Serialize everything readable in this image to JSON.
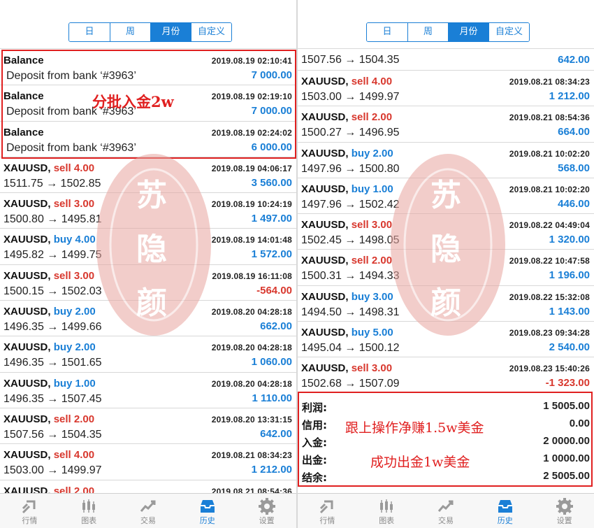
{
  "tabs_period": [
    "日",
    "周",
    "月份",
    "自定义"
  ],
  "active_period": "月份",
  "left": {
    "rows": [
      {
        "kind": "balance",
        "title": "Balance",
        "time": "2019.08.19 02:10:41",
        "desc": "Deposit from bank  ‘#3963’",
        "amount": "7 000.00"
      },
      {
        "kind": "balance",
        "title": "Balance",
        "time": "2019.08.19 02:19:10",
        "desc": "Deposit from bank  ‘#3963’",
        "amount": "7 000.00"
      },
      {
        "kind": "balance",
        "title": "Balance",
        "time": "2019.08.19 02:24:02",
        "desc": "Deposit from bank  ‘#3963’",
        "amount": "6 000.00"
      },
      {
        "kind": "trade",
        "symbol": "XAUUSD,",
        "action": "sell",
        "lots": "4.00",
        "time": "2019.08.19 04:06:17",
        "prices": "1511.75 → 1502.85",
        "amount": "3 560.00",
        "neg": false
      },
      {
        "kind": "trade",
        "symbol": "XAUUSD,",
        "action": "sell",
        "lots": "3.00",
        "time": "2019.08.19 10:24:19",
        "prices": "1500.80 → 1495.81",
        "amount": "1 497.00",
        "neg": false
      },
      {
        "kind": "trade",
        "symbol": "XAUUSD,",
        "action": "buy",
        "lots": "4.00",
        "time": "2019.08.19 14:01:48",
        "prices": "1495.82 → 1499.75",
        "amount": "1 572.00",
        "neg": false
      },
      {
        "kind": "trade",
        "symbol": "XAUUSD,",
        "action": "sell",
        "lots": "3.00",
        "time": "2019.08.19 16:11:08",
        "prices": "1500.15 → 1502.03",
        "amount": "-564.00",
        "neg": true
      },
      {
        "kind": "trade",
        "symbol": "XAUUSD,",
        "action": "buy",
        "lots": "2.00",
        "time": "2019.08.20 04:28:18",
        "prices": "1496.35 → 1499.66",
        "amount": "662.00",
        "neg": false
      },
      {
        "kind": "trade",
        "symbol": "XAUUSD,",
        "action": "buy",
        "lots": "2.00",
        "time": "2019.08.20 04:28:18",
        "prices": "1496.35 → 1501.65",
        "amount": "1 060.00",
        "neg": false
      },
      {
        "kind": "trade",
        "symbol": "XAUUSD,",
        "action": "buy",
        "lots": "1.00",
        "time": "2019.08.20 04:28:18",
        "prices": "1496.35 → 1507.45",
        "amount": "1 110.00",
        "neg": false
      },
      {
        "kind": "trade",
        "symbol": "XAUUSD,",
        "action": "sell",
        "lots": "2.00",
        "time": "2019.08.20 13:31:15",
        "prices": "1507.56 → 1504.35",
        "amount": "642.00",
        "neg": false
      },
      {
        "kind": "trade",
        "symbol": "XAUUSD,",
        "action": "sell",
        "lots": "4.00",
        "time": "2019.08.21 08:34:23",
        "prices": "1503.00 → 1499.97",
        "amount": "1 212.00",
        "neg": false
      },
      {
        "kind": "trade",
        "symbol": "XAUUSD,",
        "action": "sell",
        "lots": "2.00",
        "time": "2019.08.21 08:54:36",
        "prices": "",
        "amount": "",
        "neg": false
      }
    ],
    "annotation": "分批入金2w"
  },
  "right": {
    "first_partial": {
      "prices": "1507.56 → 1504.35",
      "amount": "642.00"
    },
    "rows": [
      {
        "kind": "trade",
        "symbol": "XAUUSD,",
        "action": "sell",
        "lots": "4.00",
        "time": "2019.08.21 08:34:23",
        "prices": "1503.00 → 1499.97",
        "amount": "1 212.00",
        "neg": false
      },
      {
        "kind": "trade",
        "symbol": "XAUUSD,",
        "action": "sell",
        "lots": "2.00",
        "time": "2019.08.21 08:54:36",
        "prices": "1500.27 → 1496.95",
        "amount": "664.00",
        "neg": false
      },
      {
        "kind": "trade",
        "symbol": "XAUUSD,",
        "action": "buy",
        "lots": "2.00",
        "time": "2019.08.21 10:02:20",
        "prices": "1497.96 → 1500.80",
        "amount": "568.00",
        "neg": false
      },
      {
        "kind": "trade",
        "symbol": "XAUUSD,",
        "action": "buy",
        "lots": "1.00",
        "time": "2019.08.21 10:02:20",
        "prices": "1497.96 → 1502.42",
        "amount": "446.00",
        "neg": false
      },
      {
        "kind": "trade",
        "symbol": "XAUUSD,",
        "action": "sell",
        "lots": "3.00",
        "time": "2019.08.22 04:49:04",
        "prices": "1502.45 → 1498.05",
        "amount": "1 320.00",
        "neg": false
      },
      {
        "kind": "trade",
        "symbol": "XAUUSD,",
        "action": "sell",
        "lots": "2.00",
        "time": "2019.08.22 10:47:58",
        "prices": "1500.31 → 1494.33",
        "amount": "1 196.00",
        "neg": false
      },
      {
        "kind": "trade",
        "symbol": "XAUUSD,",
        "action": "buy",
        "lots": "3.00",
        "time": "2019.08.22 15:32:08",
        "prices": "1494.50 → 1498.31",
        "amount": "1 143.00",
        "neg": false
      },
      {
        "kind": "trade",
        "symbol": "XAUUSD,",
        "action": "buy",
        "lots": "5.00",
        "time": "2019.08.23 09:34:28",
        "prices": "1495.04 → 1500.12",
        "amount": "2 540.00",
        "neg": false
      },
      {
        "kind": "trade",
        "symbol": "XAUUSD,",
        "action": "sell",
        "lots": "3.00",
        "time": "2019.08.23 15:40:26",
        "prices": "1502.68 → 1507.09",
        "amount": "-1 323.00",
        "neg": true
      }
    ],
    "summary": [
      {
        "label": "利润:",
        "value": "1 5005.00"
      },
      {
        "label": "信用:",
        "value": "0.00"
      },
      {
        "label": "入金:",
        "value": "2 0000.00"
      },
      {
        "label": "出金:",
        "value": "1 0000.00"
      },
      {
        "label": "结余:",
        "value": "2 5005.00"
      }
    ],
    "annotation_1": "跟上操作净赚1.5w美金",
    "annotation_2": "成功出金1w美金"
  },
  "bottom_tabs": [
    {
      "label": "行情",
      "icon": "quotes-icon"
    },
    {
      "label": "图表",
      "icon": "chart-icon"
    },
    {
      "label": "交易",
      "icon": "trade-icon"
    },
    {
      "label": "历史",
      "icon": "history-icon"
    },
    {
      "label": "设置",
      "icon": "settings-icon"
    }
  ],
  "active_tab": "历史",
  "watermark_chars": [
    "苏",
    "隐",
    "颜"
  ],
  "colors": {
    "accent": "#1a7fd6",
    "sell": "#d8382e",
    "annotation": "#e02020",
    "watermark": "#e8a6a0"
  }
}
